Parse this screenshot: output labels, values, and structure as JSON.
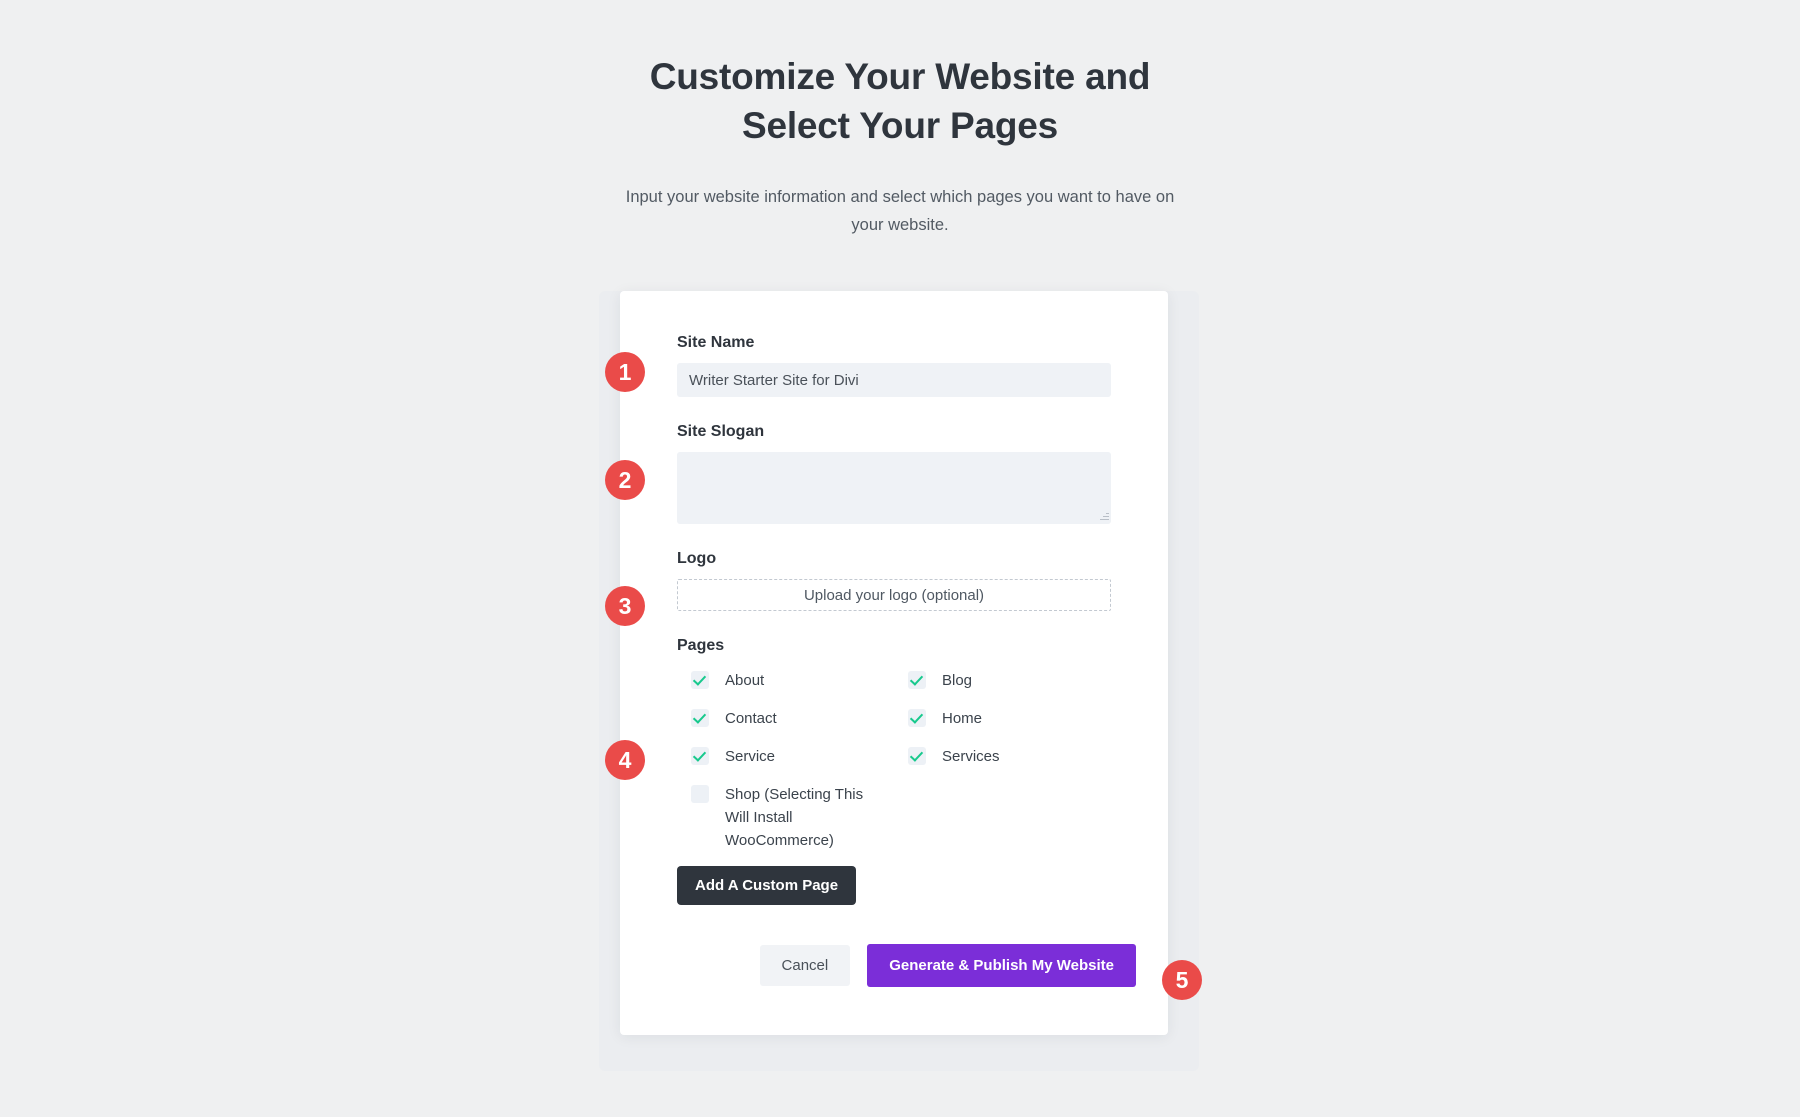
{
  "header": {
    "title": "Customize Your Website and Select Your Pages",
    "subtitle": "Input your website information and select which pages you want to have on your website."
  },
  "form": {
    "site_name": {
      "label": "Site Name",
      "value": "Writer Starter Site for Divi",
      "placeholder": ""
    },
    "site_slogan": {
      "label": "Site Slogan",
      "value": "",
      "placeholder": ""
    },
    "logo": {
      "label": "Logo",
      "upload_text": "Upload your logo (optional)"
    },
    "pages": {
      "label": "Pages",
      "items": [
        {
          "label": "About",
          "checked": true
        },
        {
          "label": "Blog",
          "checked": true
        },
        {
          "label": "Contact",
          "checked": true
        },
        {
          "label": "Home",
          "checked": true
        },
        {
          "label": "Service",
          "checked": true
        },
        {
          "label": "Services",
          "checked": true
        },
        {
          "label": "Shop (Selecting This Will Install WooCommerce)",
          "checked": false
        }
      ],
      "add_custom_page_label": "Add A Custom Page"
    }
  },
  "footer": {
    "cancel_label": "Cancel",
    "primary_label": "Generate & Publish My Website"
  },
  "badges": [
    {
      "number": "1"
    },
    {
      "number": "2"
    },
    {
      "number": "3"
    },
    {
      "number": "4"
    },
    {
      "number": "5"
    }
  ],
  "colors": {
    "badge_red": "#ea4b49",
    "primary_purple": "#7b2ed8",
    "dark_button": "#2f353d",
    "check_green": "#18c98d",
    "input_bg": "#eff2f6",
    "page_bg": "#eff0f1"
  }
}
